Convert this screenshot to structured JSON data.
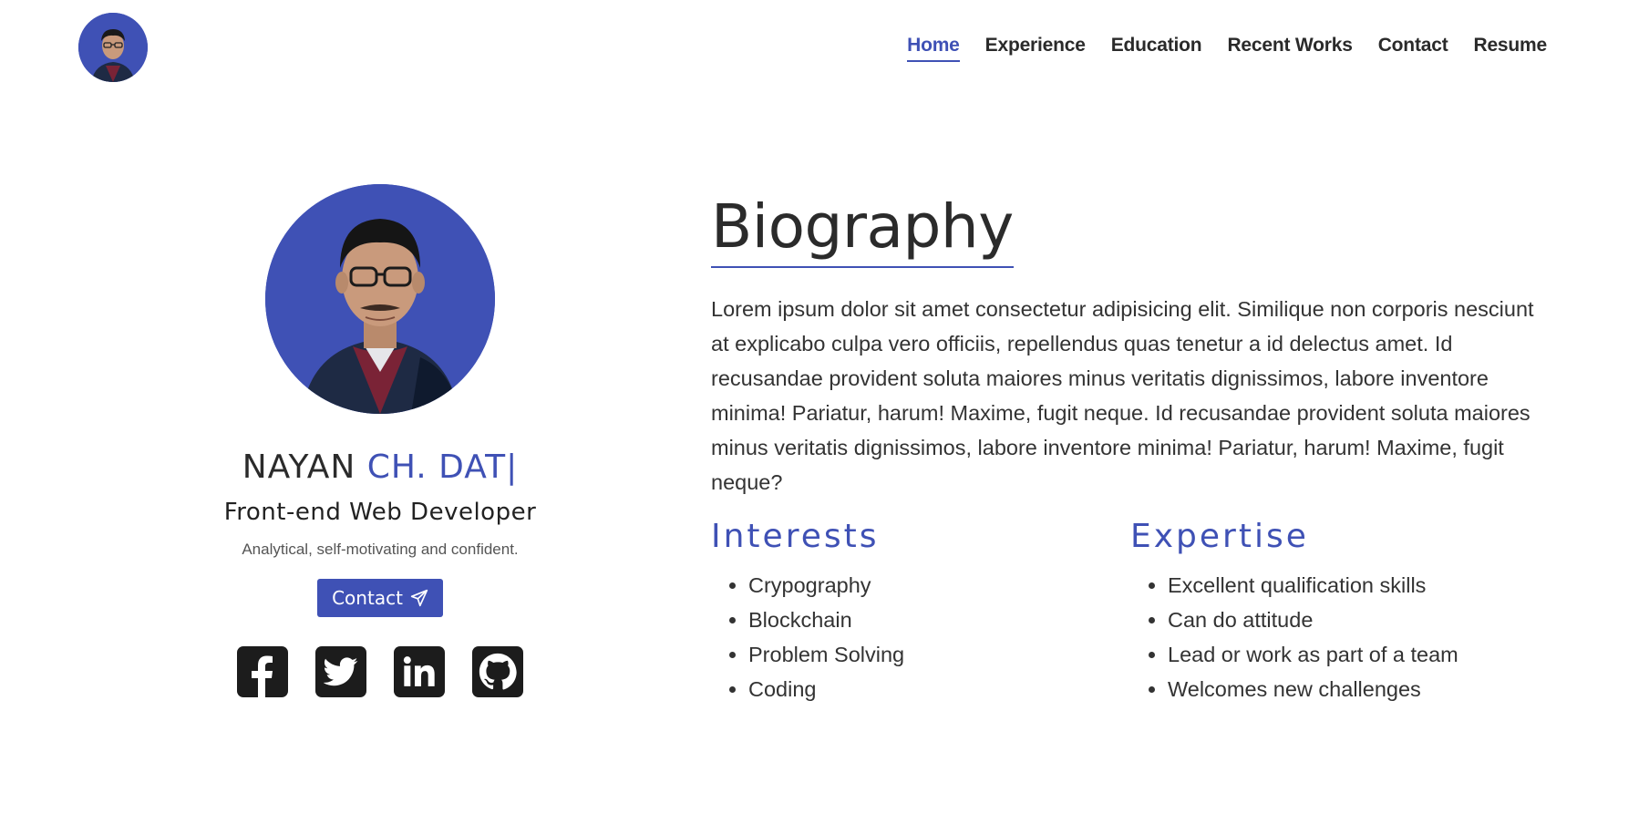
{
  "nav": {
    "avatar_alt": "profile avatar",
    "links": [
      {
        "label": "Home"
      },
      {
        "label": "Experience"
      },
      {
        "label": "Education"
      },
      {
        "label": "Recent Works"
      },
      {
        "label": "Contact"
      },
      {
        "label": "Resume"
      }
    ],
    "active_index": 0
  },
  "profile": {
    "name_first": "NAYAN ",
    "name_typed": "CH. DAT",
    "cursor": "|",
    "role": "Front-end Web Developer",
    "tagline": "Analytical, self-motivating and confident.",
    "contact_label": "Contact",
    "contact_icon": "paper-plane-icon",
    "social": [
      {
        "icon": "facebook-icon"
      },
      {
        "icon": "twitter-icon"
      },
      {
        "icon": "linkedin-icon"
      },
      {
        "icon": "github-icon"
      }
    ]
  },
  "biography": {
    "title": "Biography",
    "text": "Lorem ipsum dolor sit amet consectetur adipisicing elit. Similique non corporis nesciunt at explicabo culpa vero officiis, repellendus quas tenetur a id delectus amet. Id recusandae provident soluta maiores minus veritatis dignissimos, labore inventore minima! Pariatur, harum! Maxime, fugit neque. Id recusandae provident soluta maiores minus veritatis dignissimos, labore inventore minima! Pariatur, harum! Maxime, fugit neque?"
  },
  "interests": {
    "title": "Interests",
    "items": [
      "Crypography",
      "Blockchain",
      "Problem Solving",
      "Coding"
    ]
  },
  "expertise": {
    "title": "Expertise",
    "items": [
      "Excellent qualification skills",
      "Can do attitude",
      "Lead or work as part of a team",
      "Welcomes new challenges"
    ]
  },
  "colors": {
    "accent": "#3f51b5",
    "text": "#2b2b2b",
    "icon_dark": "#1c1c1c"
  }
}
